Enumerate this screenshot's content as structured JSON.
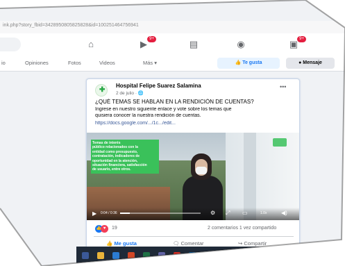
{
  "browser": {
    "url": "ink.php?story_fbid=3428950805825828&id=100251464756941"
  },
  "navbar": {
    "icons": [
      "home-icon",
      "watch-icon",
      "marketplace-icon",
      "groups-icon",
      "gaming-icon"
    ],
    "badges": {
      "watch": "9+",
      "gaming": "9+"
    }
  },
  "tabs": {
    "items": [
      "io",
      "Opiniones",
      "Fotos",
      "Videos",
      "Más ▾"
    ],
    "like_button": "Te gusta",
    "message_button": "Mensaje"
  },
  "post": {
    "page_name": "Hospital Felipe Suarez Salamina",
    "date": "2 de julio · ",
    "heading": "¿QUÉ TEMAS SE HABLAN EN LA RENDICIÓN DE CUENTAS?",
    "body_line1": "Ingrese en nuestro siguiente enlace y vote sobre los temas que",
    "body_line2": "quisiera conocer la nuestra rendición de cuentas.",
    "link": "https://docs.google.com/.../1c.../edit...",
    "video": {
      "overlay_lines": [
        "Temas de interés",
        "público relacionados con la",
        "entidad como presupuesto,",
        "contratación, indicadores de",
        "oportunidad en la atención,",
        "situación financiera, satisfacción",
        "de usuario, entre otros."
      ],
      "time": "0:04 / 0:36",
      "progress": 0.12,
      "speed": "1.0x"
    },
    "reaction_count": "19",
    "stats": "2 comentarios  1 vez compartido",
    "actions": {
      "like": "Me gusta",
      "comment": "Comentar",
      "share": "Compartir"
    }
  },
  "colors": {
    "accent": "#1877f2",
    "badge": "#e41e3f",
    "overlay_green": "#3ac15a",
    "page_bg": "#f0f2f5"
  }
}
